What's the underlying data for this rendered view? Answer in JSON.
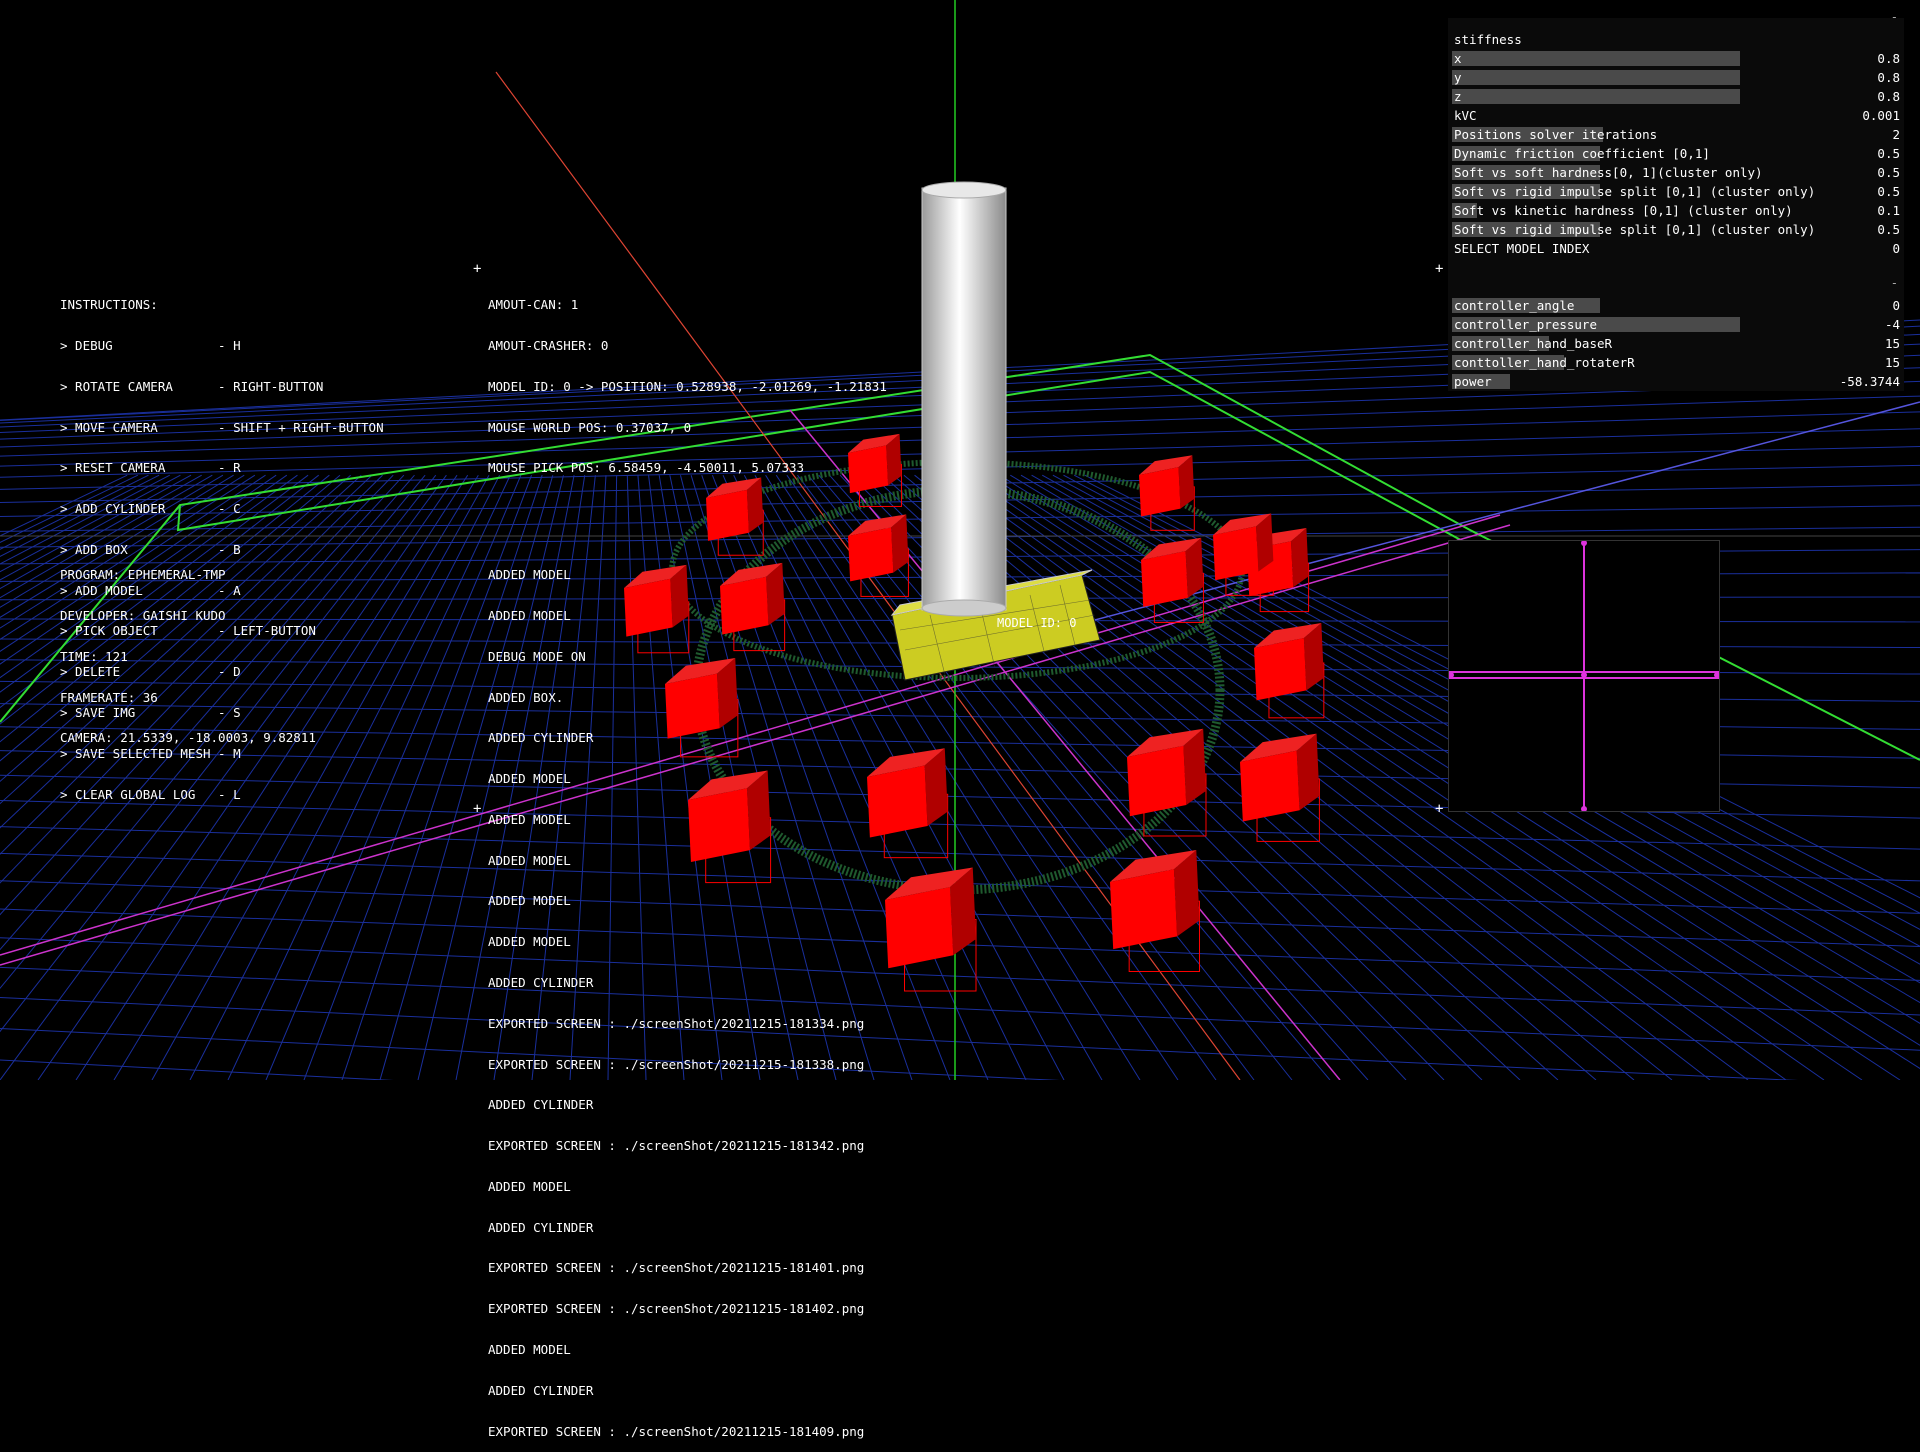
{
  "colors": {
    "background": "#000000",
    "grid": "#1a2f9c",
    "border": "#33dd33",
    "axis_x": "#dd4433",
    "axis_y": "#22cc22",
    "axis_z": "#5555dd",
    "magenta": "#cc33cc",
    "box": "#ff0000",
    "ring": "#1f5a2e",
    "panel_bar": "#4a4a4a"
  },
  "instructions": [
    "INSTRUCTIONS:",
    "> DEBUG              - H",
    "> ROTATE CAMERA      - RIGHT-BUTTON",
    "> MOVE CAMERA        - SHIFT + RIGHT-BUTTON",
    "> RESET CAMERA       - R",
    "> ADD CYLINDER       - C",
    "> ADD BOX            - B",
    "> ADD MODEL          - A",
    "> PICK OBJECT        - LEFT-BUTTON",
    "> DELETE             - D",
    "> SAVE IMG           - S",
    "> SAVE SELECTED MESH - M",
    "> CLEAR GLOBAL LOG   - L"
  ],
  "status": [
    "AMOUT-CAN: 1",
    "AMOUT-CRASHER: 0",
    "MODEL ID: 0 -> POSITION: 0.528938, -2.01269, -1.21831",
    "MOUSE WORLD POS: 0.37037, 0",
    "MOUSE PICK POS: 6.58459, -4.50011, 5.07333"
  ],
  "program_info": [
    "PROGRAM: EPHEMERAL-TMP",
    "DEVELOPER: GAISHI KUDO",
    "TIME: 121",
    "FRAMERATE: 36",
    "CAMERA: 21.5339, -18.0003, 9.82811"
  ],
  "log": [
    "ADDED MODEL",
    "ADDED MODEL",
    "DEBUG MODE ON",
    "ADDED BOX.",
    "ADDED CYLINDER",
    "ADDED MODEL",
    "ADDED MODEL",
    "ADDED MODEL",
    "ADDED MODEL",
    "ADDED MODEL",
    "ADDED CYLINDER",
    "EXPORTED SCREEN : ./screenShot/20211215-181334.png",
    "EXPORTED SCREEN : ./screenShot/20211215-181338.png",
    "ADDED CYLINDER",
    "EXPORTED SCREEN : ./screenShot/20211215-181342.png",
    "ADDED MODEL",
    "ADDED CYLINDER",
    "EXPORTED SCREEN : ./screenShot/20211215-181401.png",
    "EXPORTED SCREEN : ./screenShot/20211215-181402.png",
    "ADDED MODEL",
    "ADDED CYLINDER",
    "EXPORTED SCREEN : ./screenShot/20211215-181409.png"
  ],
  "model_label": "MODEL ID: 0",
  "panel1": {
    "dash": "-",
    "rows": [
      {
        "label": "stiffness",
        "value": "",
        "fill": 0
      },
      {
        "label": "x",
        "value": "0.8",
        "fill": 0.8
      },
      {
        "label": "y",
        "value": "0.8",
        "fill": 0.8
      },
      {
        "label": "z",
        "value": "0.8",
        "fill": 0.8
      },
      {
        "label": "kVC",
        "value": "0.001",
        "fill": 0
      },
      {
        "label": "Positions solver iterations",
        "value": "2",
        "fill": 0.42
      },
      {
        "label": "Dynamic friction coefficient [0,1]",
        "value": "0.5",
        "fill": 0.41
      },
      {
        "label": "Soft vs soft hardness[0, 1](cluster only)",
        "value": "0.5",
        "fill": 0.41
      },
      {
        "label": "Soft vs rigid impulse split [0,1] (cluster only)",
        "value": "0.5",
        "fill": 0.41
      },
      {
        "label": "Soft vs kinetic hardness [0,1] (cluster only)",
        "value": "0.1",
        "fill": 0.07
      },
      {
        "label": "Soft vs rigid impulse split [0,1] (cluster only)",
        "value": "0.5",
        "fill": 0.41
      },
      {
        "label": "SELECT MODEL INDEX",
        "value": "0",
        "fill": 0
      }
    ]
  },
  "panel2": {
    "dash": "-",
    "rows": [
      {
        "label": "controller_angle",
        "value": "0",
        "fill": 0.41
      },
      {
        "label": "controller_pressure",
        "value": "-4",
        "fill": 0.8
      },
      {
        "label": "controller_hand_baseR",
        "value": "15",
        "fill": 0.27
      },
      {
        "label": "conttoller_hand_rotaterR",
        "value": "15",
        "fill": 0.31
      },
      {
        "label": "power",
        "value": "-58.3744",
        "fill": 0.16
      }
    ]
  },
  "cross_glyph": "+"
}
